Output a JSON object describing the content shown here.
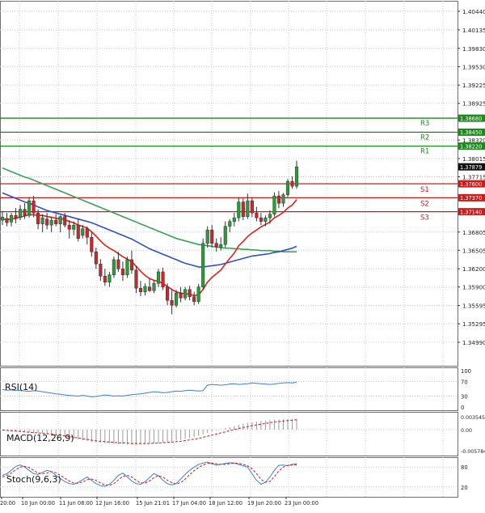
{
  "colors": {
    "grid": "#c8c8c8",
    "bull": "#2a9d3a",
    "bear": "#d0232a",
    "ma_fast": "#e0201a",
    "ma_mid": "#3050c8",
    "ma_slow": "#3aa35a",
    "resistance": "#1a8a1a",
    "support": "#d01a1a",
    "indicator": "#3a7fd5",
    "signal": "#d01a1a"
  },
  "chart_data": [
    {
      "type": "candlestick",
      "title": "",
      "ylim": [
        1.3499,
        1.4044
      ],
      "y_ticks": [
        "1.40440",
        "1.40135",
        "1.39830",
        "1.39530",
        "1.39225",
        "1.38925",
        "1.38320",
        "1.38015",
        "1.37715",
        "1.36805",
        "1.36505",
        "1.36200",
        "1.35900",
        "1.35595",
        "1.35295",
        "1.34990"
      ],
      "x_ticks": [
        "20:00",
        "10 Jun 00:00",
        "11 Jun 08:00",
        "12 Jun 16:00",
        "15 Jun 21:01",
        "17 Jun 04:00",
        "18 Jun 12:00",
        "19 Jun 20:00",
        "23 Jun 00:00"
      ],
      "candles": [
        {
          "o": 1.37,
          "h": 1.3715,
          "l": 1.3692,
          "c": 1.3705
        },
        {
          "o": 1.3703,
          "h": 1.3712,
          "l": 1.369,
          "c": 1.3696
        },
        {
          "o": 1.3697,
          "h": 1.3712,
          "l": 1.369,
          "c": 1.3708
        },
        {
          "o": 1.3708,
          "h": 1.372,
          "l": 1.3695,
          "c": 1.3704
        },
        {
          "o": 1.3705,
          "h": 1.3725,
          "l": 1.37,
          "c": 1.3718
        },
        {
          "o": 1.3718,
          "h": 1.3728,
          "l": 1.3702,
          "c": 1.3708
        },
        {
          "o": 1.3708,
          "h": 1.3738,
          "l": 1.3704,
          "c": 1.3732
        },
        {
          "o": 1.3732,
          "h": 1.374,
          "l": 1.3705,
          "c": 1.3712
        },
        {
          "o": 1.3712,
          "h": 1.3718,
          "l": 1.3685,
          "c": 1.3694
        },
        {
          "o": 1.3694,
          "h": 1.371,
          "l": 1.368,
          "c": 1.3704
        },
        {
          "o": 1.3702,
          "h": 1.3712,
          "l": 1.3685,
          "c": 1.3692
        },
        {
          "o": 1.3692,
          "h": 1.3705,
          "l": 1.368,
          "c": 1.37
        },
        {
          "o": 1.37,
          "h": 1.371,
          "l": 1.369,
          "c": 1.3694
        },
        {
          "o": 1.3694,
          "h": 1.3708,
          "l": 1.368,
          "c": 1.3706
        },
        {
          "o": 1.3706,
          "h": 1.3712,
          "l": 1.3688,
          "c": 1.3692
        },
        {
          "o": 1.3692,
          "h": 1.37,
          "l": 1.367,
          "c": 1.3685
        },
        {
          "o": 1.3685,
          "h": 1.3698,
          "l": 1.3675,
          "c": 1.3692
        },
        {
          "o": 1.3692,
          "h": 1.3702,
          "l": 1.3665,
          "c": 1.367
        },
        {
          "o": 1.3675,
          "h": 1.3692,
          "l": 1.367,
          "c": 1.3686
        },
        {
          "o": 1.3686,
          "h": 1.369,
          "l": 1.366,
          "c": 1.3672
        },
        {
          "o": 1.3672,
          "h": 1.368,
          "l": 1.364,
          "c": 1.3648
        },
        {
          "o": 1.3648,
          "h": 1.3655,
          "l": 1.362,
          "c": 1.3628
        },
        {
          "o": 1.3628,
          "h": 1.3636,
          "l": 1.36,
          "c": 1.3608
        },
        {
          "o": 1.3608,
          "h": 1.362,
          "l": 1.3592,
          "c": 1.3598
        },
        {
          "o": 1.3598,
          "h": 1.3615,
          "l": 1.359,
          "c": 1.361
        },
        {
          "o": 1.361,
          "h": 1.364,
          "l": 1.3605,
          "c": 1.3635
        },
        {
          "o": 1.3635,
          "h": 1.3648,
          "l": 1.3615,
          "c": 1.362
        },
        {
          "o": 1.362,
          "h": 1.3632,
          "l": 1.36,
          "c": 1.361
        },
        {
          "o": 1.361,
          "h": 1.364,
          "l": 1.3605,
          "c": 1.3635
        },
        {
          "o": 1.3635,
          "h": 1.365,
          "l": 1.3612,
          "c": 1.3618
        },
        {
          "o": 1.3618,
          "h": 1.3625,
          "l": 1.358,
          "c": 1.3588
        },
        {
          "o": 1.3588,
          "h": 1.36,
          "l": 1.3575,
          "c": 1.3582
        },
        {
          "o": 1.3582,
          "h": 1.3596,
          "l": 1.3576,
          "c": 1.3591
        },
        {
          "o": 1.359,
          "h": 1.3605,
          "l": 1.3582,
          "c": 1.3584
        },
        {
          "o": 1.3584,
          "h": 1.36,
          "l": 1.358,
          "c": 1.3596
        },
        {
          "o": 1.3596,
          "h": 1.362,
          "l": 1.359,
          "c": 1.3615
        },
        {
          "o": 1.3615,
          "h": 1.3622,
          "l": 1.3585,
          "c": 1.359
        },
        {
          "o": 1.359,
          "h": 1.3596,
          "l": 1.356,
          "c": 1.3568
        },
        {
          "o": 1.3568,
          "h": 1.3585,
          "l": 1.3545,
          "c": 1.356
        },
        {
          "o": 1.356,
          "h": 1.3585,
          "l": 1.3556,
          "c": 1.358
        },
        {
          "o": 1.358,
          "h": 1.359,
          "l": 1.3565,
          "c": 1.3572
        },
        {
          "o": 1.3572,
          "h": 1.359,
          "l": 1.3568,
          "c": 1.3586
        },
        {
          "o": 1.3586,
          "h": 1.3592,
          "l": 1.3568,
          "c": 1.3574
        },
        {
          "o": 1.3574,
          "h": 1.3582,
          "l": 1.356,
          "c": 1.3566
        },
        {
          "o": 1.3566,
          "h": 1.3595,
          "l": 1.3562,
          "c": 1.359
        },
        {
          "o": 1.359,
          "h": 1.367,
          "l": 1.3585,
          "c": 1.3662
        },
        {
          "o": 1.3662,
          "h": 1.369,
          "l": 1.3655,
          "c": 1.3684
        },
        {
          "o": 1.3684,
          "h": 1.3692,
          "l": 1.3655,
          "c": 1.3662
        },
        {
          "o": 1.3662,
          "h": 1.367,
          "l": 1.3648,
          "c": 1.3656
        },
        {
          "o": 1.3656,
          "h": 1.3672,
          "l": 1.365,
          "c": 1.366
        },
        {
          "o": 1.366,
          "h": 1.3698,
          "l": 1.3655,
          "c": 1.369
        },
        {
          "o": 1.369,
          "h": 1.3702,
          "l": 1.368,
          "c": 1.3698
        },
        {
          "o": 1.3698,
          "h": 1.3712,
          "l": 1.369,
          "c": 1.3704
        },
        {
          "o": 1.3704,
          "h": 1.3738,
          "l": 1.3698,
          "c": 1.373
        },
        {
          "o": 1.373,
          "h": 1.3736,
          "l": 1.37,
          "c": 1.3706
        },
        {
          "o": 1.3706,
          "h": 1.3744,
          "l": 1.3702,
          "c": 1.3732
        },
        {
          "o": 1.3732,
          "h": 1.3738,
          "l": 1.3705,
          "c": 1.3712
        },
        {
          "o": 1.3712,
          "h": 1.3722,
          "l": 1.3698,
          "c": 1.3704
        },
        {
          "o": 1.3704,
          "h": 1.3712,
          "l": 1.3692,
          "c": 1.3698
        },
        {
          "o": 1.3698,
          "h": 1.3708,
          "l": 1.369,
          "c": 1.3704
        },
        {
          "o": 1.3704,
          "h": 1.3716,
          "l": 1.3694,
          "c": 1.371
        },
        {
          "o": 1.371,
          "h": 1.3746,
          "l": 1.3706,
          "c": 1.374
        },
        {
          "o": 1.374,
          "h": 1.3748,
          "l": 1.372,
          "c": 1.3728
        },
        {
          "o": 1.3728,
          "h": 1.3745,
          "l": 1.3722,
          "c": 1.3742
        },
        {
          "o": 1.3742,
          "h": 1.3768,
          "l": 1.3738,
          "c": 1.3764
        },
        {
          "o": 1.3764,
          "h": 1.3772,
          "l": 1.3752,
          "c": 1.3756
        },
        {
          "o": 1.3756,
          "h": 1.3798,
          "l": 1.3752,
          "c": 1.3788
        }
      ],
      "ma_fast": [
        1.3702,
        1.3701,
        1.3702,
        1.3703,
        1.3705,
        1.3707,
        1.3709,
        1.3709,
        1.3708,
        1.3708,
        1.3706,
        1.3705,
        1.3703,
        1.3703,
        1.3701,
        1.3698,
        1.3696,
        1.3692,
        1.369,
        1.3687,
        1.3681,
        1.3674,
        1.3666,
        1.3659,
        1.3654,
        1.365,
        1.3645,
        1.364,
        1.3636,
        1.3632,
        1.3624,
        1.3616,
        1.3609,
        1.3604,
        1.3601,
        1.3599,
        1.3596,
        1.3591,
        1.3586,
        1.3582,
        1.358,
        1.3579,
        1.3578,
        1.3576,
        1.3577,
        1.3586,
        1.3598,
        1.3606,
        1.3612,
        1.3618,
        1.3628,
        1.3637,
        1.3646,
        1.3658,
        1.3665,
        1.3673,
        1.3679,
        1.3684,
        1.3689,
        1.3693,
        1.3697,
        1.3704,
        1.3708,
        1.3713,
        1.372,
        1.3725,
        1.3734
      ],
      "ma_mid": [
        1.3745,
        1.3742,
        1.3739,
        1.3736,
        1.3733,
        1.373,
        1.3728,
        1.3725,
        1.3722,
        1.3719,
        1.3716,
        1.3714,
        1.3712,
        1.371,
        1.3708,
        1.3706,
        1.3704,
        1.3702,
        1.37,
        1.3698,
        1.3696,
        1.3693,
        1.369,
        1.3687,
        1.3684,
        1.3681,
        1.3678,
        1.3675,
        1.3672,
        1.3669,
        1.3665,
        1.3661,
        1.3657,
        1.3653,
        1.365,
        1.3647,
        1.3644,
        1.3641,
        1.3638,
        1.3635,
        1.3632,
        1.3629,
        1.3627,
        1.3625,
        1.3623,
        1.3623,
        1.3624,
        1.3625,
        1.3626,
        1.3627,
        1.3629,
        1.3631,
        1.3633,
        1.3635,
        1.3637,
        1.3639,
        1.3641,
        1.3642,
        1.3643,
        1.3644,
        1.3645,
        1.3647,
        1.3648,
        1.365,
        1.3652,
        1.3654,
        1.3657
      ],
      "ma_slow": [
        1.3786,
        1.3783,
        1.378,
        1.3777,
        1.3774,
        1.3771,
        1.3769,
        1.3766,
        1.3763,
        1.376,
        1.3757,
        1.3754,
        1.3751,
        1.3748,
        1.3745,
        1.3742,
        1.3739,
        1.3736,
        1.3733,
        1.373,
        1.3727,
        1.3724,
        1.3721,
        1.3718,
        1.3715,
        1.3712,
        1.3709,
        1.3706,
        1.3703,
        1.37,
        1.3697,
        1.3694,
        1.3691,
        1.3688,
        1.3685,
        1.3682,
        1.3679,
        1.3676,
        1.3673,
        1.367,
        1.3668,
        1.3666,
        1.3664,
        1.3662,
        1.366,
        1.3659,
        1.3658,
        1.3657,
        1.3656,
        1.3655,
        1.3654,
        1.3654,
        1.3653,
        1.3653,
        1.3652,
        1.3652,
        1.3651,
        1.3651,
        1.365,
        1.365,
        1.365,
        1.3649,
        1.3649,
        1.3648,
        1.3648,
        1.3648,
        1.3648
      ],
      "levels": [
        {
          "label": "R3",
          "value": 1.3868,
          "price_tag": "1.38680",
          "kind": "resistance"
        },
        {
          "label": "R2",
          "value": 1.3845,
          "price_tag": "1.38450",
          "kind": "resistance"
        },
        {
          "label": "R1",
          "value": 1.3822,
          "price_tag": "1.38220",
          "kind": "resistance"
        },
        {
          "label": "S1",
          "value": 1.376,
          "price_tag": "1.37600",
          "kind": "support"
        },
        {
          "label": "S2",
          "value": 1.3737,
          "price_tag": "1.37370",
          "kind": "support"
        },
        {
          "label": "S3",
          "value": 1.3714,
          "price_tag": "1.37140",
          "kind": "support"
        }
      ],
      "current_price": {
        "value": 1.37879,
        "tag": "1.37879"
      }
    },
    {
      "type": "line",
      "title": "RSI(14)",
      "ylim": [
        0,
        100
      ],
      "y_ticks": [
        "100",
        "70",
        "30",
        "0"
      ],
      "values": [
        48,
        46,
        47,
        45,
        46,
        44,
        43,
        45,
        44,
        42,
        40,
        38,
        36,
        35,
        33,
        32,
        31,
        30,
        32,
        30,
        28,
        29,
        31,
        33,
        32,
        30,
        31,
        30,
        32,
        34,
        35,
        36,
        38,
        40,
        42,
        41,
        39,
        40,
        42,
        44,
        43,
        45,
        46,
        45,
        44,
        45,
        60,
        62,
        61,
        60,
        61,
        63,
        64,
        62,
        63,
        64,
        66,
        65,
        64,
        63,
        62,
        63,
        65,
        66,
        67,
        66,
        68
      ]
    },
    {
      "type": "bar",
      "title": "MACD(12,26,9)",
      "ylim": [
        -0.005784,
        0.003545
      ],
      "y_ticks": [
        "0.003545",
        "0.00",
        "-0.005784"
      ],
      "values": [
        -0.0002,
        -0.0003,
        -0.0004,
        -0.0005,
        -0.0006,
        -0.0007,
        -0.0008,
        -0.0009,
        -0.001,
        -0.0011,
        -0.0013,
        -0.0015,
        -0.0017,
        -0.0019,
        -0.0021,
        -0.0023,
        -0.0025,
        -0.0027,
        -0.0029,
        -0.0031,
        -0.0033,
        -0.0035,
        -0.0036,
        -0.0037,
        -0.0038,
        -0.0039,
        -0.004,
        -0.004,
        -0.0041,
        -0.0041,
        -0.0041,
        -0.004,
        -0.004,
        -0.0039,
        -0.0038,
        -0.0037,
        -0.0036,
        -0.0034,
        -0.0032,
        -0.003,
        -0.0028,
        -0.0026,
        -0.0023,
        -0.002,
        -0.0017,
        -0.0013,
        -0.0009,
        -0.0005,
        -0.0002,
        0.0001,
        0.0004,
        0.0007,
        0.001,
        0.0013,
        0.0016,
        0.0018,
        0.002,
        0.0022,
        0.0024,
        0.0025,
        0.0026,
        0.0027,
        0.0028,
        0.0028,
        0.0029,
        0.0029,
        0.0029
      ],
      "signal": [
        -0.0001,
        -0.0002,
        -0.0003,
        -0.0004,
        -0.0005,
        -0.0006,
        -0.0007,
        -0.0008,
        -0.0009,
        -0.001,
        -0.0011,
        -0.0012,
        -0.0014,
        -0.0015,
        -0.0017,
        -0.0019,
        -0.0021,
        -0.0023,
        -0.0025,
        -0.0027,
        -0.0029,
        -0.0031,
        -0.0032,
        -0.0033,
        -0.0034,
        -0.0035,
        -0.0036,
        -0.0036,
        -0.0037,
        -0.0038,
        -0.0038,
        -0.0038,
        -0.0038,
        -0.0038,
        -0.0037,
        -0.0037,
        -0.0036,
        -0.0035,
        -0.0034,
        -0.0033,
        -0.0032,
        -0.003,
        -0.0028,
        -0.0026,
        -0.0024,
        -0.0021,
        -0.0018,
        -0.0015,
        -0.0012,
        -0.0009,
        -0.0006,
        -0.0003,
        0.0,
        0.0003,
        0.0006,
        0.0008,
        0.0011,
        0.0013,
        0.0015,
        0.0017,
        0.0019,
        0.0021,
        0.0022,
        0.0024,
        0.0025,
        0.0026,
        0.0027
      ]
    },
    {
      "type": "line",
      "title": "Stoch(9,6,3)",
      "ylim": [
        0,
        100
      ],
      "y_ticks": [
        "80",
        "20"
      ],
      "k": [
        55,
        60,
        70,
        82,
        86,
        80,
        70,
        60,
        58,
        64,
        70,
        66,
        55,
        45,
        36,
        30,
        28,
        34,
        42,
        50,
        40,
        30,
        24,
        22,
        28,
        40,
        55,
        62,
        50,
        38,
        30,
        28,
        36,
        48,
        60,
        54,
        40,
        30,
        26,
        30,
        44,
        58,
        70,
        80,
        88,
        92,
        95,
        90,
        86,
        88,
        91,
        93,
        92,
        88,
        84,
        80,
        60,
        40,
        28,
        34,
        50,
        70,
        85,
        86,
        84,
        88,
        90
      ],
      "d": [
        50,
        55,
        62,
        72,
        80,
        82,
        78,
        70,
        62,
        60,
        62,
        66,
        63,
        55,
        46,
        38,
        32,
        31,
        35,
        42,
        44,
        40,
        32,
        26,
        25,
        30,
        41,
        52,
        55,
        50,
        40,
        32,
        32,
        38,
        48,
        54,
        50,
        40,
        33,
        29,
        33,
        44,
        57,
        69,
        79,
        86,
        91,
        92,
        90,
        88,
        88,
        90,
        92,
        91,
        88,
        84,
        75,
        60,
        43,
        34,
        37,
        51,
        68,
        80,
        85,
        86,
        87
      ]
    }
  ]
}
